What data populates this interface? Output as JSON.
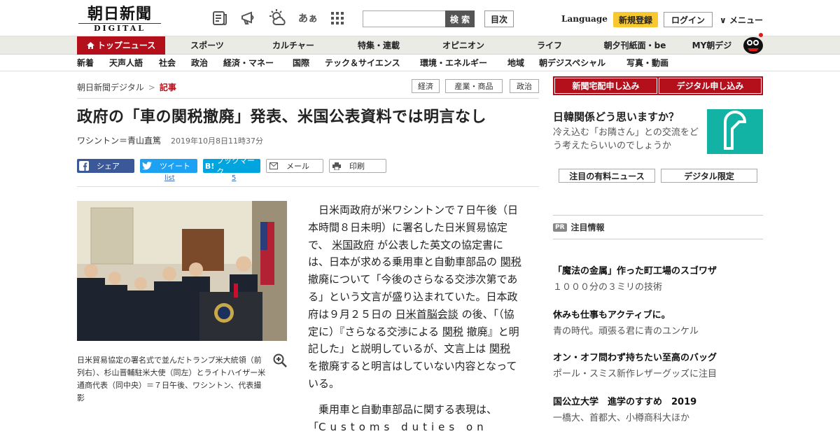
{
  "header": {
    "logo_jp": "朝日新聞",
    "logo_en": "DIGITAL",
    "font_size_label": "あぁ",
    "search_placeholder": "",
    "search_button": "検 索",
    "toc_button": "目次",
    "language": "Language",
    "register": "新規登録",
    "login": "ログイン",
    "menu": "メニュー"
  },
  "nav_primary": {
    "top": "トップニュース",
    "items": [
      "スポーツ",
      "カルチャー",
      "特集・連載",
      "オピニオン",
      "ライフ",
      "朝夕刊紙面・be",
      "MY朝デジ"
    ]
  },
  "nav_secondary": {
    "items": [
      "新着",
      "天声人語",
      "社会",
      "政治",
      "経済・マネー",
      "国際",
      "テック＆サイエンス",
      "環境・エネルギー",
      "地域",
      "朝デジスペシャル",
      "写真・動画"
    ]
  },
  "breadcrumb": {
    "home": "朝日新聞デジタル",
    "separator": ">",
    "current": "記事"
  },
  "tags": [
    "経済",
    "産業・商品",
    "政治"
  ],
  "article": {
    "title": "政府の「車の関税撤廃」発表、米国公表資料では明言なし",
    "author": "ワシントン＝青山直篤",
    "date": "2019年10月8日11時37分",
    "caption": "日米貿易協定の署名式で並んだトランプ米大統領（前列右）、杉山晋輔駐米大使（同左）とライトハイザー米通商代表（同中央）＝７日午後、ワシントン、代表撮影",
    "p1": {
      "a": "日米両政府が米ワシントンで７日午後（日本時間８日未明）に署名した日米貿易協定で、",
      "k1": "米国政府",
      "b": "が公表した英文の協定書には、日本が求める乗用車と自動車部品の",
      "k2": "関税",
      "c": "撤廃について「今後のさらなる交渉次第である」という文言が盛り込まれていた。日本政府は９月２５日の",
      "k3": "日米首脳会談",
      "d": "の後、「（協定に）『さらなる交渉による",
      "k4": "関税",
      "e": "撤廃』と明記した」と説明しているが、文言上は",
      "k5": "関税",
      "f": "を撤廃すると明言はしていない内容となっている。"
    },
    "p2": {
      "a": "乗用車と自動車部品に関する表現は、「",
      "b": "Customs duties on"
    }
  },
  "share": {
    "facebook": "シェア",
    "twitter": "ツイート",
    "twitter_count": "list",
    "hatena": "ブックマーク",
    "hatena_icon": "B!",
    "hatena_count": "5",
    "mail": "メール",
    "print": "印刷"
  },
  "sidebar": {
    "subscribe_paper": "新聞宅配申し込み",
    "subscribe_digital": "デジタル申し込み",
    "ad_title": "日韓関係どう思いますか？",
    "ad_text": "冷え込む「お隣さん」との交流をどう考えたらいいのでしょうか",
    "tab_paid": "注目の有料ニュース",
    "tab_digital": "デジタル限定",
    "pr_badge": "PR",
    "pr_heading": "注目情報",
    "pr_items": [
      {
        "title": "「魔法の金属」作った町工場のスゴワザ",
        "sub": "１０００分の３ミリの技術"
      },
      {
        "title": "休みも仕事もアクティブに。",
        "sub": "青の時代。頑張る君に青のユンケル"
      },
      {
        "title": "オン・オフ問わず持ちたい至高のバッグ",
        "sub": "ポール・スミス新作レザーグッズに注目"
      },
      {
        "title": "国公立大学　進学のすすめ　2019",
        "sub": "一橋大、首都大、小樽商科大ほか"
      }
    ]
  },
  "colors": {
    "brand_red": "#b3101c",
    "register_yellow": "#f7c830",
    "ad_teal": "#12b3a4"
  }
}
